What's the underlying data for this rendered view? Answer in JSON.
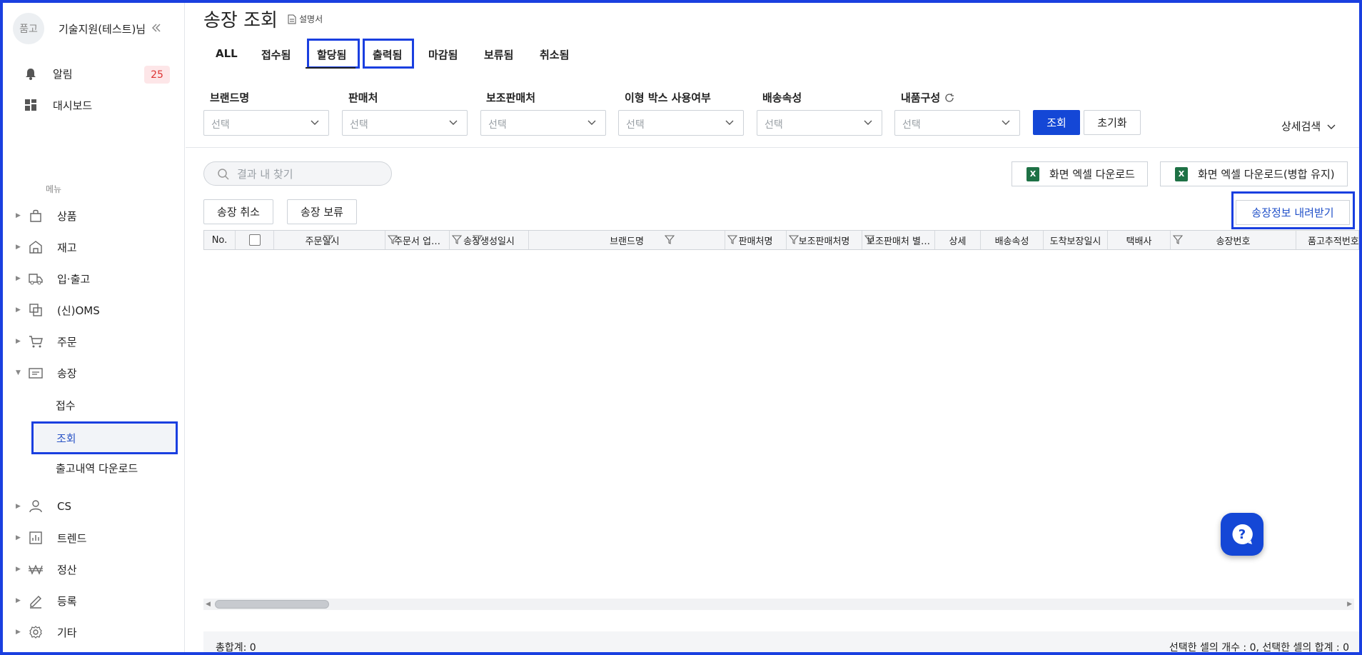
{
  "sidebar": {
    "avatar_text": "품고",
    "user_name": "기술지원(테스트)님",
    "alerts_label": "알림",
    "alerts_count": "25",
    "dashboard_label": "대시보드",
    "menu_caption": "메뉴",
    "menu": [
      {
        "label": "상품",
        "icon": "box-icon"
      },
      {
        "label": "재고",
        "icon": "warehouse-icon"
      },
      {
        "label": "입·출고",
        "icon": "truck-icon"
      },
      {
        "label": "(신)OMS",
        "icon": "oms-icon"
      },
      {
        "label": "주문",
        "icon": "cart-icon"
      },
      {
        "label": "송장",
        "icon": "invoice-icon",
        "expanded": true
      },
      {
        "label": "CS",
        "icon": "person-icon"
      },
      {
        "label": "트렌드",
        "icon": "chart-icon"
      },
      {
        "label": "정산",
        "icon": "won-icon"
      },
      {
        "label": "등록",
        "icon": "pencil-icon"
      },
      {
        "label": "기타",
        "icon": "gear-icon"
      }
    ],
    "submenu": [
      "접수",
      "조회",
      "출고내역 다운로드"
    ]
  },
  "page": {
    "title": "송장 조회",
    "manual_label": "설명서",
    "tabs": [
      "ALL",
      "접수됨",
      "할당됨",
      "출력됨",
      "마감됨",
      "보류됨",
      "취소됨"
    ]
  },
  "filters": {
    "labels": [
      "브랜드명",
      "판매처",
      "보조판매처",
      "이형 박스 사용여부",
      "배송속성",
      "내품구성"
    ],
    "placeholder": "선택",
    "search_button": "조회",
    "reset_button": "초기화",
    "detail_search": "상세검색"
  },
  "toolbar": {
    "search_placeholder": "결과 내 찾기",
    "excel_download": "화면 엑셀 다운로드",
    "excel_download_merge": "화면 엑셀 다운로드(병합 유지)",
    "cancel_invoice": "송장 취소",
    "hold_invoice": "송장 보류",
    "download_invoice_info": "송장정보 내려받기"
  },
  "grid": {
    "columns": [
      "No.",
      "",
      "주문일시",
      "주문서 업…",
      "송장생성일시",
      "브랜드명",
      "판매처명",
      "보조판매처명",
      "보조판매처 별…",
      "상세",
      "배송속성",
      "도착보장일시",
      "택배사",
      "송장번호",
      "품고추적번호"
    ]
  },
  "footer": {
    "total": "총합계: 0",
    "selection": "선택한 셀의 개수 : 0, 선택한 셀의 합계 : 0"
  },
  "colors": {
    "accent": "#1447d6",
    "highlight": "#1a3fe0",
    "badge_bg": "#fde6e8",
    "badge_text": "#d33333",
    "excel": "#1e7145"
  }
}
